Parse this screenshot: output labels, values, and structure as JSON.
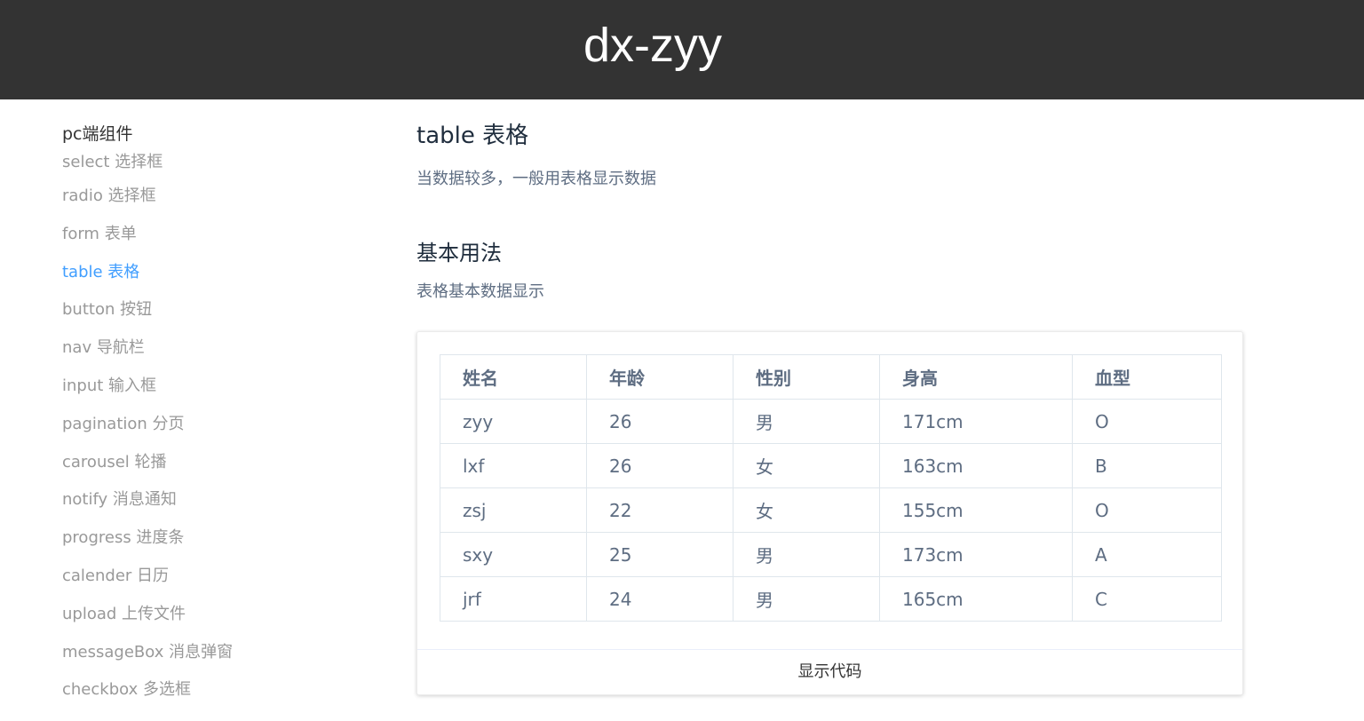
{
  "header": {
    "brand": "dx-zyy"
  },
  "sidebar": {
    "title": "pc端组件",
    "items": [
      {
        "label": "select 选择框",
        "active": false
      },
      {
        "label": "radio 选择框",
        "active": false
      },
      {
        "label": "form 表单",
        "active": false
      },
      {
        "label": "table 表格",
        "active": true
      },
      {
        "label": "button 按钮",
        "active": false
      },
      {
        "label": "nav 导航栏",
        "active": false
      },
      {
        "label": "input 输入框",
        "active": false
      },
      {
        "label": "pagination 分页",
        "active": false
      },
      {
        "label": "carousel 轮播",
        "active": false
      },
      {
        "label": "notify 消息通知",
        "active": false
      },
      {
        "label": "progress 进度条",
        "active": false
      },
      {
        "label": "calender 日历",
        "active": false
      },
      {
        "label": "upload 上传文件",
        "active": false
      },
      {
        "label": "messageBox 消息弹窗",
        "active": false
      },
      {
        "label": "checkbox 多选框",
        "active": false
      }
    ]
  },
  "main": {
    "title": "table 表格",
    "description": "当数据较多，一般用表格显示数据",
    "section": {
      "title": "基本用法",
      "description": "表格基本数据显示"
    },
    "table": {
      "columns": [
        "姓名",
        "年龄",
        "性别",
        "身高",
        "血型"
      ],
      "rows": [
        [
          "zyy",
          "26",
          "男",
          "171cm",
          "O"
        ],
        [
          "lxf",
          "26",
          "女",
          "163cm",
          "B"
        ],
        [
          "zsj",
          "22",
          "女",
          "155cm",
          "O"
        ],
        [
          "sxy",
          "25",
          "男",
          "173cm",
          "A"
        ],
        [
          "jrf",
          "24",
          "男",
          "165cm",
          "C"
        ]
      ]
    },
    "show_code_label": "显示代码"
  },
  "colors": {
    "header_bg": "#333333",
    "accent": "#409eff",
    "sidebar_text": "#999999",
    "table_text": "#5e6d82",
    "border": "#dfe6ec"
  }
}
